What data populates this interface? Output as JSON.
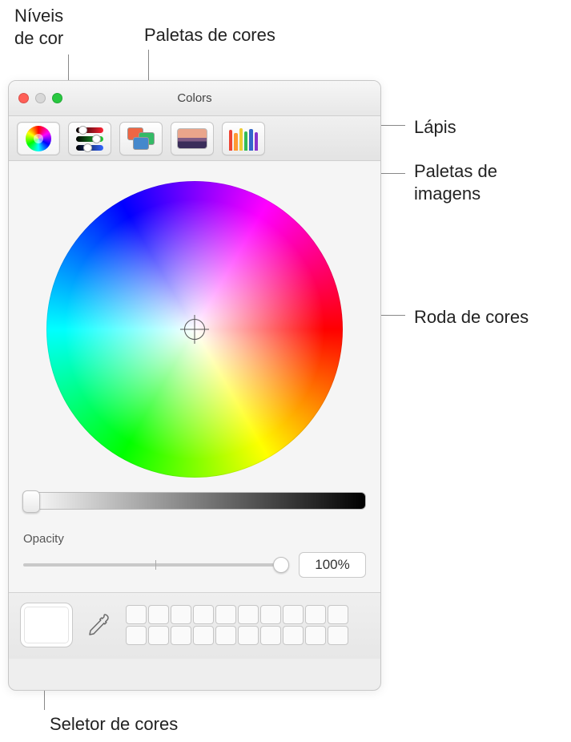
{
  "callouts": {
    "sliders": "Níveis\nde cor",
    "palettes": "Paletas de cores",
    "pencils": "Lápis",
    "imagePalettes": "Paletas de\nimagens",
    "wheel": "Roda de cores",
    "swatch": "Seletor de cores"
  },
  "window": {
    "title": "Colors"
  },
  "toolbar": {
    "wheel_name": "color-wheel-mode-icon",
    "sliders_name": "color-sliders-mode-icon",
    "palettes_name": "color-palettes-mode-icon",
    "image_name": "image-palettes-mode-icon",
    "pencils_name": "pencils-mode-icon"
  },
  "opacity": {
    "label": "Opacity",
    "value": "100%"
  }
}
